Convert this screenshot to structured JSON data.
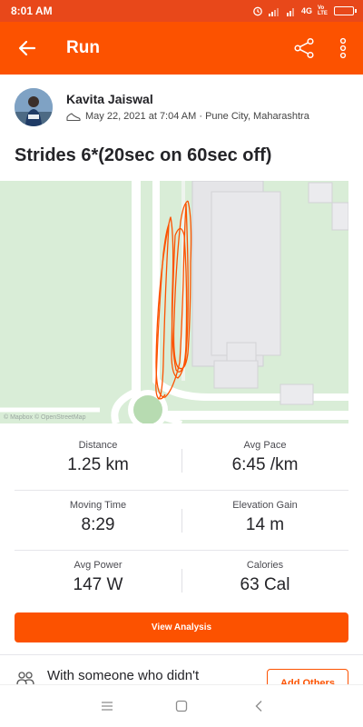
{
  "status_bar": {
    "time": "8:01 AM",
    "network": "4G",
    "volte": "Vo LTE",
    "icons": [
      "alarm-icon",
      "signal-icon",
      "signal-icon",
      "battery-icon"
    ]
  },
  "header": {
    "title": "Run",
    "icons": [
      "back-arrow-icon",
      "share-icon",
      "more-vertical-icon"
    ]
  },
  "athlete": {
    "name": "Kavita Jaiswal",
    "date": "May 22, 2021 at 7:04 AM · Pune City, Maharashtra",
    "icons": [
      "shoe-icon"
    ]
  },
  "activity": {
    "title": "Strides 6*(20sec on 60sec off)"
  },
  "map": {
    "attribution": "© Mapbox © OpenStreetMap",
    "route_color": "#fc5200"
  },
  "stats": [
    {
      "label": "Distance",
      "value": "1.25 km"
    },
    {
      "label": "Avg Pace",
      "value": "6:45 /km"
    },
    {
      "label": "Moving Time",
      "value": "8:29"
    },
    {
      "label": "Elevation Gain",
      "value": "14 m"
    },
    {
      "label": "Avg Power",
      "value": "147 W"
    },
    {
      "label": "Calories",
      "value": "63 Cal"
    }
  ],
  "actions": {
    "view_analysis": "View Analysis"
  },
  "together": {
    "text": "With someone who didn't",
    "add_others": "Add Others",
    "icon": "people-icon"
  },
  "nav": {
    "icons": [
      "menu-icon",
      "home-icon",
      "back-icon"
    ]
  },
  "colors": {
    "brand": "#fc5200",
    "status_bar": "#e8481a"
  }
}
